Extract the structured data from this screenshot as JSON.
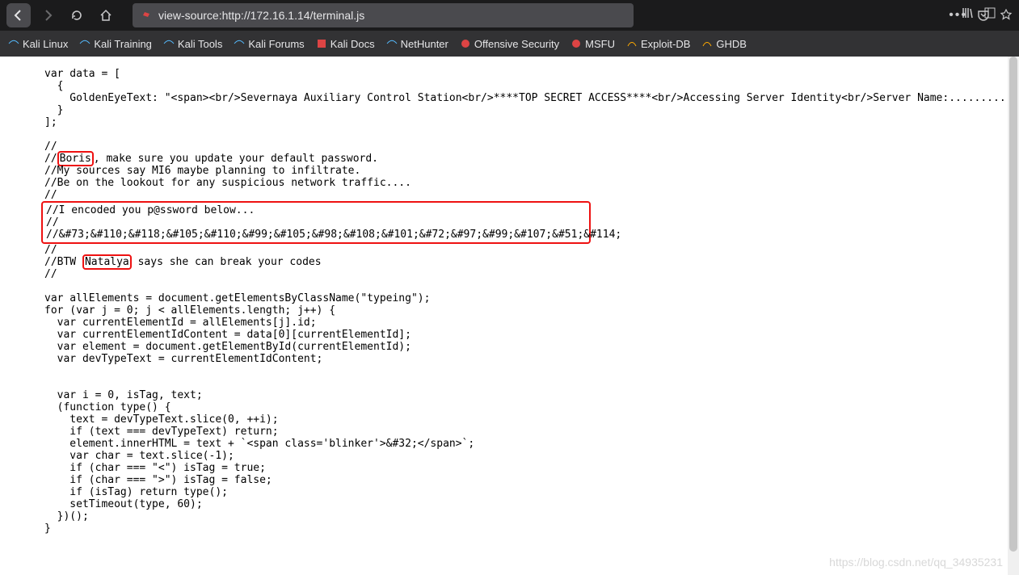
{
  "url": "view-source:http://172.16.1.14/terminal.js",
  "bookmarks": [
    {
      "label": "Kali Linux"
    },
    {
      "label": "Kali Training"
    },
    {
      "label": "Kali Tools"
    },
    {
      "label": "Kali Forums"
    },
    {
      "label": "Kali Docs"
    },
    {
      "label": "NetHunter"
    },
    {
      "label": "Offensive Security"
    },
    {
      "label": "MSFU"
    },
    {
      "label": "Exploit-DB"
    },
    {
      "label": "GHDB"
    }
  ],
  "highlights": {
    "name1": "Boris",
    "name2": "Natalya"
  },
  "code": {
    "l1": "var data = [",
    "l2": "  {",
    "l3": "    GoldenEyeText: \"<span><br/>Severnaya Auxiliary Control Station<br/>****TOP SECRET ACCESS****<br/>Accessing Server Identity<br/>Server Name:....................<br/",
    "l4": "  }",
    "l5": "];",
    "l6": "",
    "l7": "//",
    "l8a": "//",
    "l8b": ", make sure you update your default password.",
    "l9": "//My sources say MI6 maybe planning to infiltrate. ",
    "l10": "//Be on the lookout for any suspicious network traffic....",
    "l11": "//",
    "box1": "//I encoded you p@ssword below...",
    "box2": "//",
    "box3": "//&#73;&#110;&#118;&#105;&#110;&#99;&#105;&#98;&#108;&#101;&#72;&#97;&#99;&#107;&#51;&#114;",
    "l12": "//",
    "l13a": "//BTW ",
    "l13b": " says she can break your codes",
    "l14": "//",
    "l15": "",
    "l16": "var allElements = document.getElementsByClassName(\"typeing\");",
    "l17": "for (var j = 0; j < allElements.length; j++) {",
    "l18": "  var currentElementId = allElements[j].id;",
    "l19": "  var currentElementIdContent = data[0][currentElementId];",
    "l20": "  var element = document.getElementById(currentElementId);",
    "l21": "  var devTypeText = currentElementIdContent;",
    "l22": "",
    "l23": " ",
    "l24": "  var i = 0, isTag, text;",
    "l25": "  (function type() {",
    "l26": "    text = devTypeText.slice(0, ++i);",
    "l27": "    if (text === devTypeText) return;",
    "l28": "    element.innerHTML = text + `<span class='blinker'>&#32;</span>`;",
    "l29": "    var char = text.slice(-1);",
    "l30": "    if (char === \"<\") isTag = true;",
    "l31": "    if (char === \">\") isTag = false;",
    "l32": "    if (isTag) return type();",
    "l33": "    setTimeout(type, 60);",
    "l34": "  })();",
    "l35": "}"
  },
  "watermark": "https://blog.csdn.net/qq_34935231"
}
